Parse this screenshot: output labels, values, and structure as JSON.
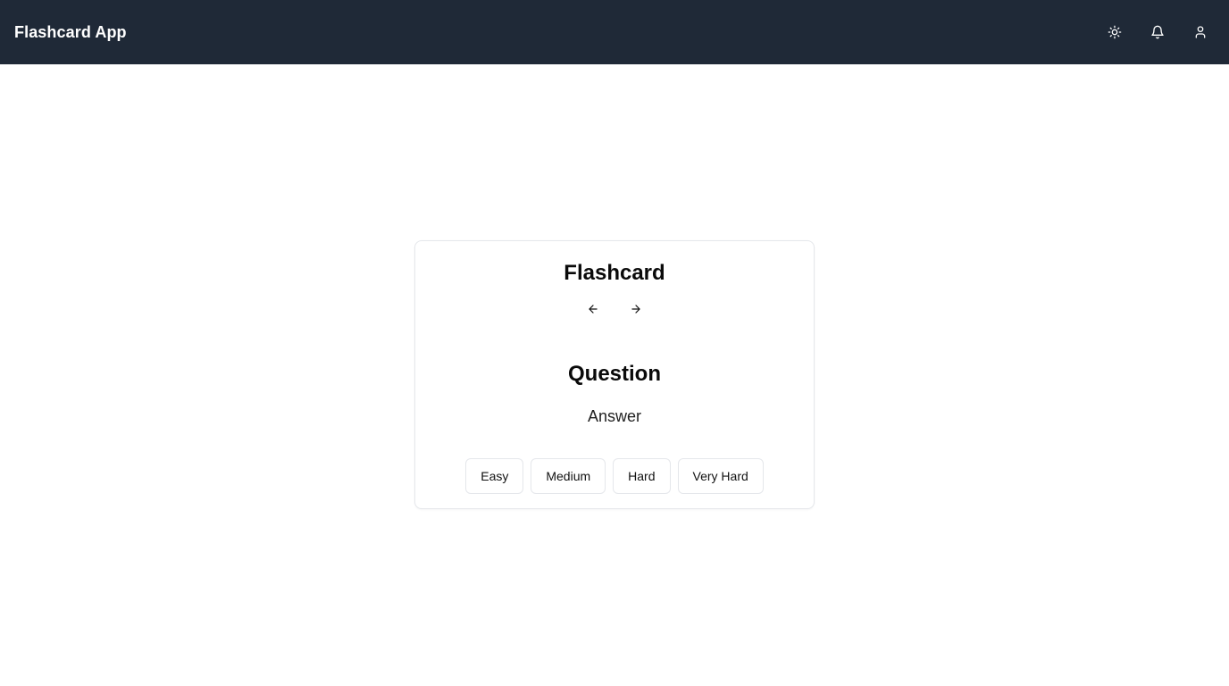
{
  "header": {
    "title": "Flashcard App",
    "actions": [
      {
        "icon": "sun-icon"
      },
      {
        "icon": "bell-icon"
      },
      {
        "icon": "user-icon"
      }
    ],
    "background_color": "#1f2937"
  },
  "card": {
    "title": "Flashcard",
    "prev_icon": "arrow-left-icon",
    "next_icon": "arrow-right-icon",
    "question": "Question",
    "answer": "Answer",
    "difficulty_buttons": [
      "Easy",
      "Medium",
      "Hard",
      "Very Hard"
    ]
  }
}
